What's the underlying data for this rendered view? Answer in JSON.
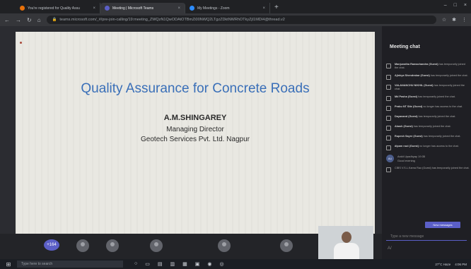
{
  "browser": {
    "tabs": [
      {
        "title": "You're registered for Quality Assu",
        "fav_color": "#e8710a"
      },
      {
        "title": "Meeting | Microsoft Teams",
        "fav_color": "#5b5fc7"
      },
      {
        "title": "My Meetings - Zoom",
        "fav_color": "#2d8cff"
      }
    ],
    "close_glyph": "×",
    "newtab_glyph": "+",
    "url": "teams.microsoft.com/_#/pre-join-calling/19:meeting_ZWQzN1QwODAtOTBmZi00NWQ2LTgzZDktNWRhOTkyZjI1MDI4@thread.v2",
    "window_controls": [
      "–",
      "□",
      "×"
    ]
  },
  "slide": {
    "title": "Quality Assurance for Concrete Roads",
    "presenter": "A.M.SHINGAREY",
    "role": "Managing Director",
    "company": "Geotech Services Pvt. Ltd. Nagpur"
  },
  "participants": {
    "overflow_count": "+164"
  },
  "chat": {
    "title": "Meeting chat",
    "messages": [
      {
        "name": "Manjunatha Ramachandra (Guest)",
        "text": "has temporarily joined the chat."
      },
      {
        "name": "Ajinkya Shendrakar (Guest)",
        "text": "has temporarily joined the chat."
      },
      {
        "name": "VALANANCHU NIKHIL (Guest)",
        "text": "has temporarily joined the chat."
      },
      {
        "name": "Md Pasha (Guest)",
        "text": "has temporarily joined the chat."
      },
      {
        "name": "Prabu NT Site (Guest)",
        "text": "no longer has access to the chat."
      },
      {
        "name": "Dayanand (Guest)",
        "text": "has temporarily joined the chat."
      },
      {
        "name": "Akash (Guest)",
        "text": "has temporarily joined the chat."
      },
      {
        "name": "Rupesh Sayre (Guest)",
        "text": "has temporarily joined the chat."
      },
      {
        "name": "dipam rout (Guest)",
        "text": "no longer has access to the chat."
      }
    ],
    "reply": {
      "initials": "AU",
      "name": "Ankit Upadhyay",
      "time": "19:35",
      "text": "Good evening"
    },
    "last_msg": "CIBS V.S.L.Karna Rao (Guest) has temporarily joined the chat.",
    "new_messages_label": "New messages",
    "compose_placeholder": "Type a new message"
  },
  "taskbar": {
    "search_placeholder": "Type here to search",
    "weather": "27°C Haze",
    "time": "4:06 PM"
  }
}
